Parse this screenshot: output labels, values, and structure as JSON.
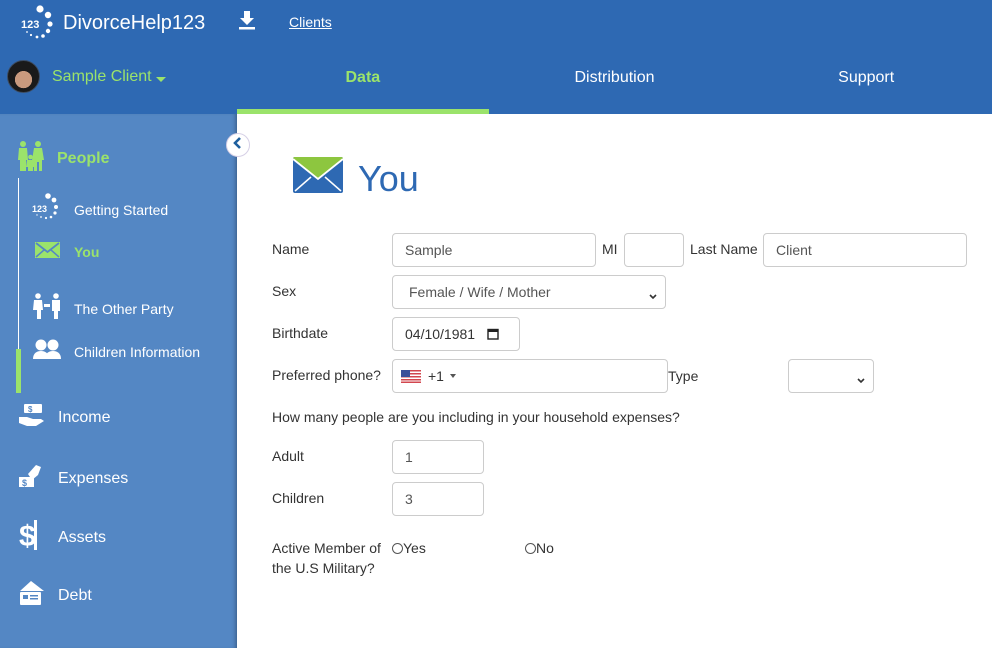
{
  "header": {
    "brand_name": "DivorceHelp123",
    "logo_text": "123",
    "clients_link": "Clients",
    "user_name": "Sample Client",
    "tabs": [
      {
        "label": "Data",
        "active": true
      },
      {
        "label": "Distribution",
        "active": false
      },
      {
        "label": "Support",
        "active": false
      }
    ]
  },
  "sidebar": {
    "group": {
      "label": "People",
      "icon": "family-icon"
    },
    "sub_items": [
      {
        "label": "Getting Started",
        "icon": "logo-123-icon",
        "active": false
      },
      {
        "label": "You",
        "icon": "envelope-icon",
        "active": true
      },
      {
        "label": "The Other Party",
        "icon": "couple-icon",
        "active": false
      },
      {
        "label": "Children Information",
        "icon": "children-icon",
        "active": false
      }
    ],
    "main_items": [
      {
        "label": "Income",
        "icon": "money-hand-icon"
      },
      {
        "label": "Expenses",
        "icon": "hand-pay-icon"
      },
      {
        "label": "Assets",
        "icon": "dollar-icon"
      },
      {
        "label": "Debt",
        "icon": "credit-card-icon"
      }
    ]
  },
  "page": {
    "title": "You",
    "form": {
      "name_label": "Name",
      "first_name": "Sample",
      "mi_label": "MI",
      "mi_value": "",
      "last_name_label": "Last Name",
      "last_name": "Client",
      "sex_label": "Sex",
      "sex_value": "Female / Wife / Mother",
      "birthdate_label": "Birthdate",
      "birthdate_value": "04/10/1981",
      "phone_label": "Preferred phone?",
      "phone_country_code": "+1",
      "phone_value": "",
      "type_label": "Type",
      "type_value": "",
      "household_question": "How many people are you including in your household expenses?",
      "adult_label": "Adult",
      "adult_value": "1",
      "children_label": "Children",
      "children_value": "3",
      "military_label_line1": "Active Member of",
      "military_label_line2": "the U.S Military?",
      "military_yes": "Yes",
      "military_no": "No"
    }
  },
  "colors": {
    "header_bg": "#2e69b3",
    "sidebar_bg": "#5487c4",
    "accent_green": "#9be36b",
    "title_blue": "#2e69b3"
  }
}
